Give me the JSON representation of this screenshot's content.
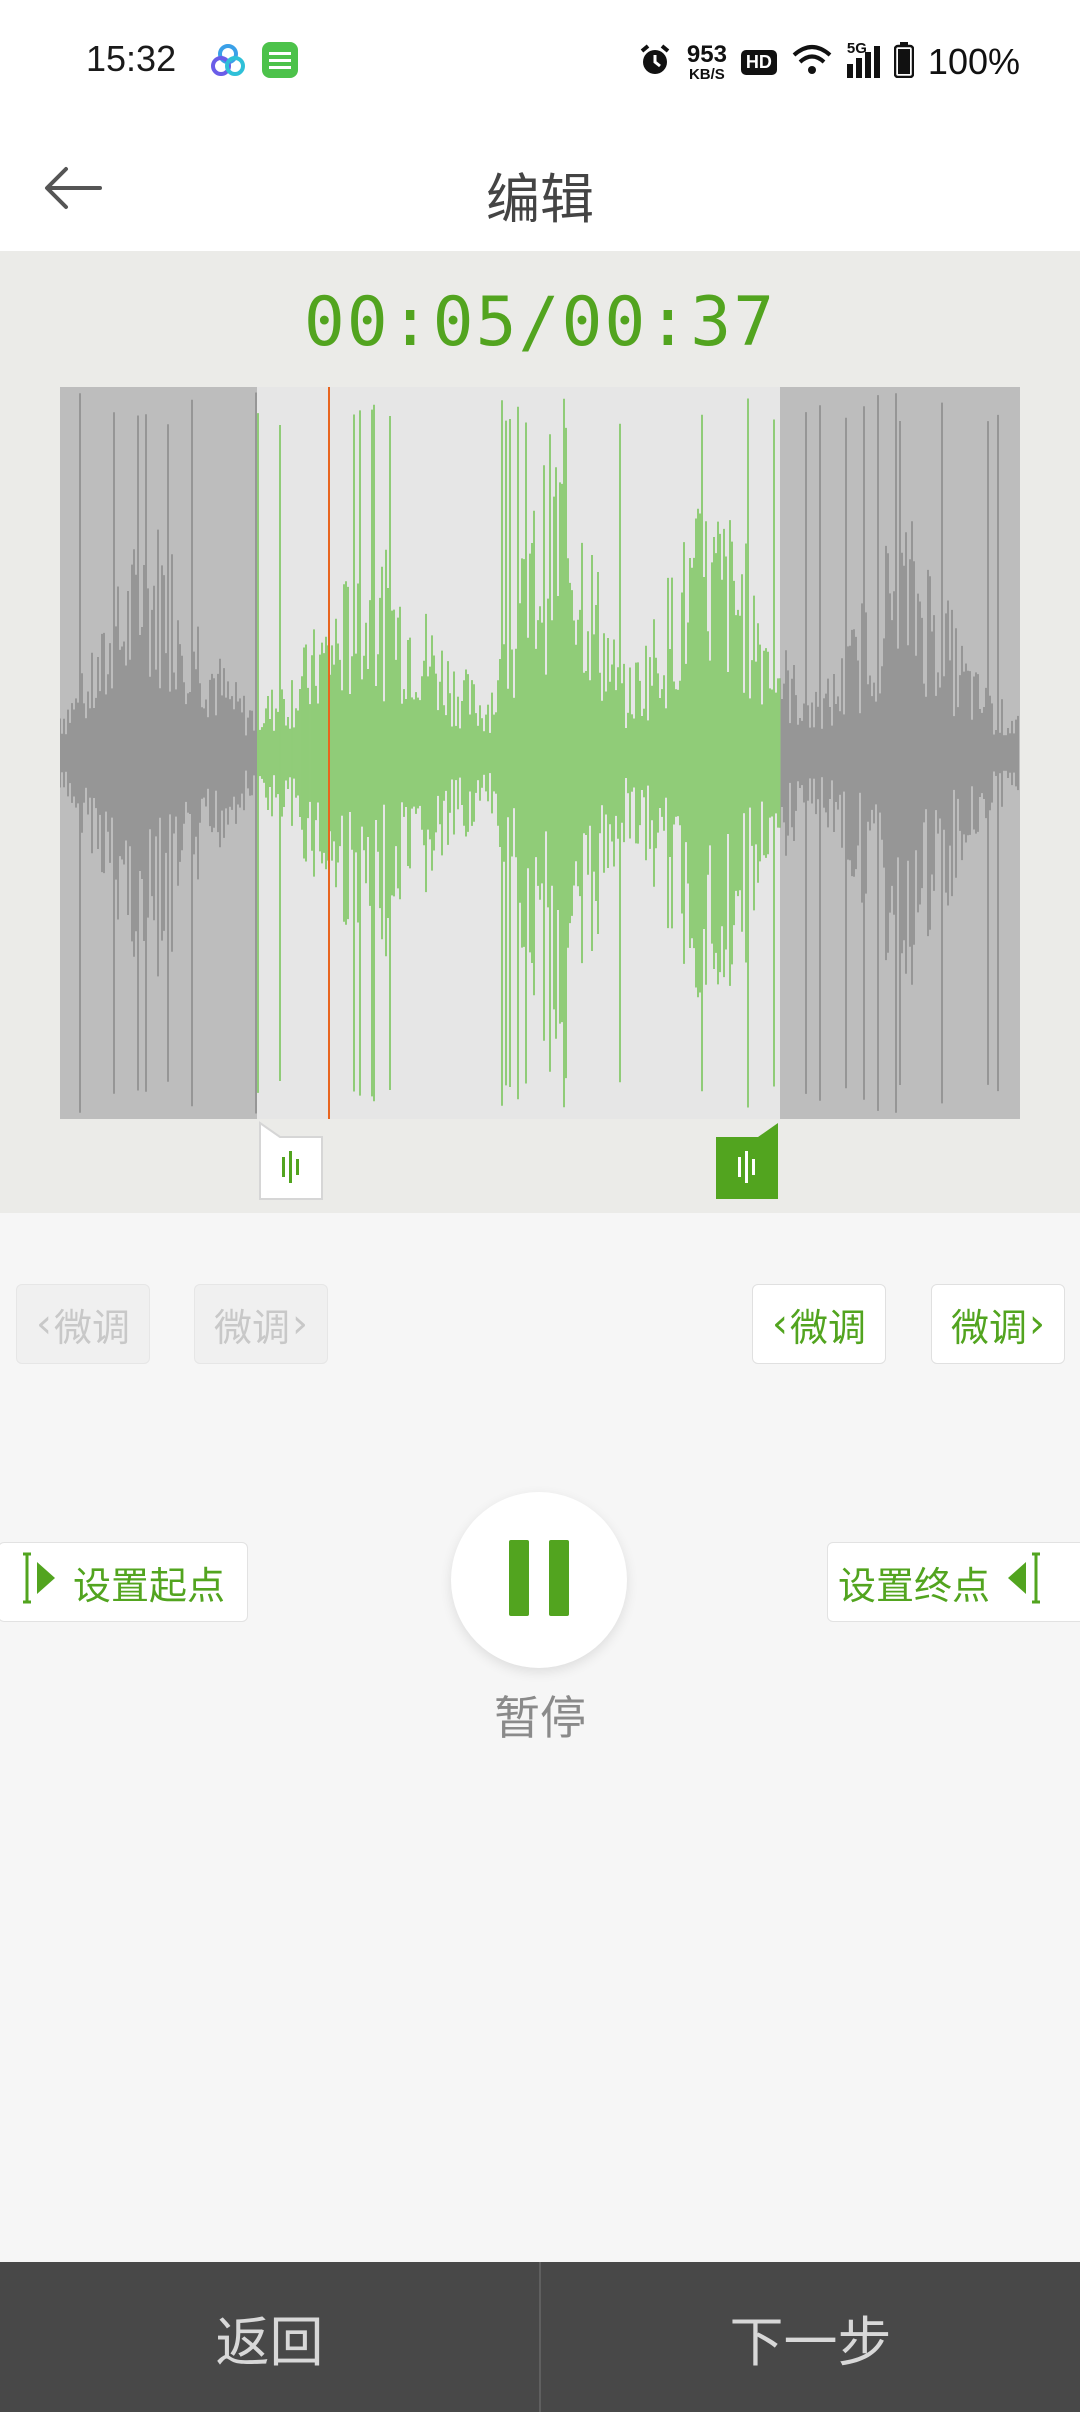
{
  "status_bar": {
    "time": "15:32",
    "speed_value": "953",
    "speed_unit": "KB/S",
    "hd": "HD",
    "network": "5G",
    "battery": "100%",
    "icons": [
      "alarm-icon",
      "wifi-icon",
      "signal-icon",
      "battery-icon"
    ]
  },
  "header": {
    "title": "编辑",
    "back_icon": "arrow-left-icon"
  },
  "player": {
    "time_display": "00:05/00:37",
    "current_seconds": 5,
    "total_seconds": 37,
    "selection_start_fraction": 0.205,
    "selection_end_fraction": 0.75,
    "playhead_fraction": 0.28,
    "colors": {
      "accent": "#52a41f",
      "wave_selected": "#6cc04a",
      "wave_unselected": "#6d6d6d",
      "dim_overlay": "#9a9a9a",
      "playhead": "#e8651f"
    }
  },
  "fine_tune": {
    "start_left": "微调",
    "start_right": "微调",
    "end_left": "微调",
    "end_right": "微调"
  },
  "controls": {
    "set_start": "设置起点",
    "set_end": "设置终点",
    "pause_label": "暂停"
  },
  "bottom": {
    "back": "返回",
    "next": "下一步"
  }
}
